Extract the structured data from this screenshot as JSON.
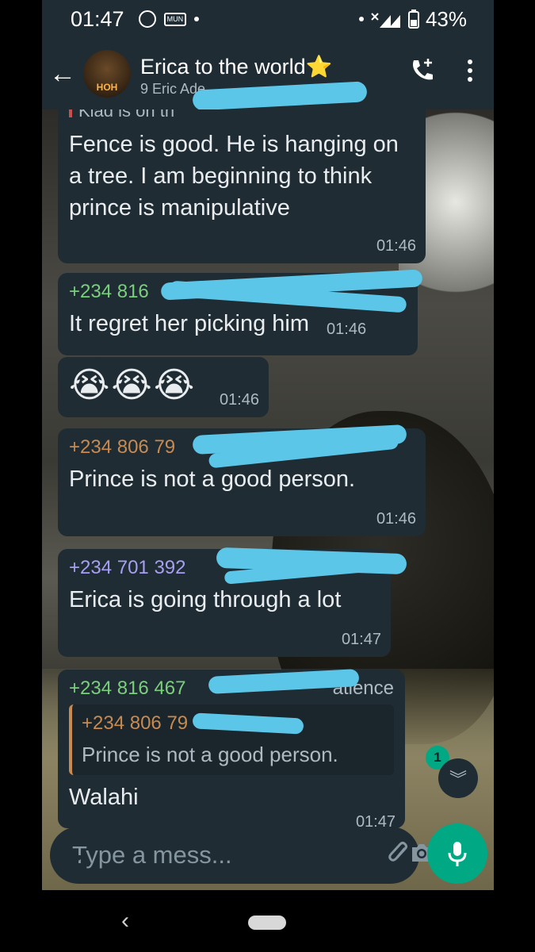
{
  "status_bar": {
    "time": "01:47",
    "badge": "MUN",
    "battery": "43%"
  },
  "header": {
    "avatar_label": "HOH",
    "title": "Erica to the world⭐",
    "subtitle": "9 Eric Ade..."
  },
  "messages": [
    {
      "partial_top": "Kiad is on th",
      "text": "Fence is good. He is hanging on a tree. I am beginning to think prince is manipulative",
      "time": "01:46"
    },
    {
      "sender": "+234 816",
      "sender_color": "#7ad07a",
      "text": "It regret her picking him",
      "time": "01:46"
    },
    {
      "emoji": "😭😭😭",
      "time": "01:46"
    },
    {
      "sender": "+234 806 79",
      "sender_color": "#c98a4f",
      "text": "Prince is not a good person.",
      "time": "01:46"
    },
    {
      "sender": "+234 701 392",
      "sender_color": "#a79ff2",
      "text": "Erica is going through a lot",
      "time": "01:47"
    },
    {
      "sender": "+234 816 467",
      "sender_suffix": "atience",
      "sender_color": "#7ad07a",
      "quote_sender": "+234 806 79",
      "quote_text": "Prince is not a good person.",
      "text": "Walahi",
      "time": "01:47"
    }
  ],
  "scroll": {
    "unread_count": "1"
  },
  "composer": {
    "placeholder": "Type a mess..."
  },
  "colors": {
    "bubble": "#1f2c34",
    "accent": "#00a884"
  }
}
